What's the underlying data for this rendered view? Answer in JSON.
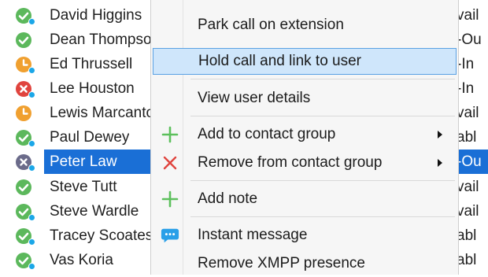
{
  "contacts": [
    {
      "name": "David Higgins",
      "status": "available",
      "right": "vail"
    },
    {
      "name": "Dean Thompson",
      "status": "available",
      "right": "-Ou"
    },
    {
      "name": "Ed Thrussell",
      "status": "away",
      "right": "-In"
    },
    {
      "name": "Lee Houston",
      "status": "busy",
      "right": "-In"
    },
    {
      "name": "Lewis Marcantonio",
      "status": "away",
      "right": "vail"
    },
    {
      "name": "Paul Dewey",
      "status": "available",
      "right": "abl"
    },
    {
      "name": "Peter Law",
      "status": "offline",
      "right": "-Ou",
      "selected": true
    },
    {
      "name": "Steve Tutt",
      "status": "available",
      "right": "vail"
    },
    {
      "name": "Steve Wardle",
      "status": "available",
      "right": "vail"
    },
    {
      "name": "Tracey Scoates",
      "status": "available",
      "right": "abl"
    },
    {
      "name": "Vas Koria",
      "status": "available",
      "right": "abl"
    }
  ],
  "menu": {
    "park_call": "Park call on extension",
    "hold_call": "Hold call and link to user",
    "view_user": "View user details",
    "add_to_group": "Add to contact group",
    "remove_from_group": "Remove from contact group",
    "add_note": "Add note",
    "instant_message": "Instant message",
    "remove_xmpp": "Remove XMPP presence"
  },
  "colors": {
    "available": "#5cb85c",
    "away": "#f0a030",
    "busy": "#e0443e",
    "offline": "#6b6b8a",
    "selection": "#1a6fd6",
    "menu_highlight": "#cfe6fb",
    "add_icon": "#5cc05c",
    "remove_icon": "#e0443e",
    "message_icon": "#2aa0e8"
  }
}
